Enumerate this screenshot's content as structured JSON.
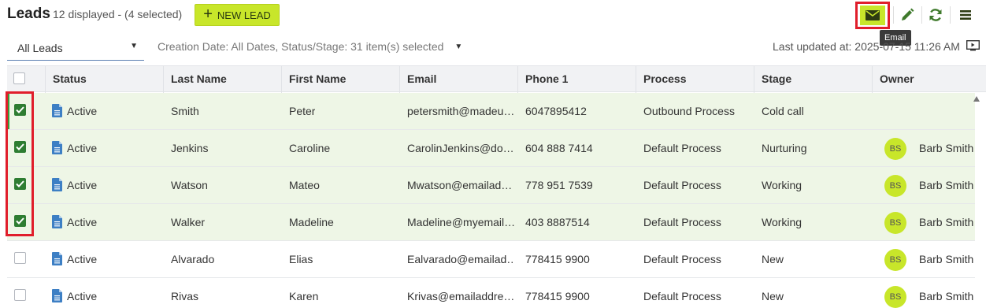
{
  "header": {
    "title": "Leads",
    "subtitle": "12 displayed - (4 selected)",
    "new_lead_label": "NEW LEAD",
    "tooltip": "Email"
  },
  "filters": {
    "view": "All Leads",
    "criteria": "Creation Date: All Dates, Status/Stage: 31 item(s) selected",
    "last_updated": "Last updated at: 2025-07-15 11:26 AM"
  },
  "table": {
    "columns": [
      "Status",
      "Last Name",
      "First Name",
      "Email",
      "Phone 1",
      "Process",
      "Stage",
      "Owner"
    ],
    "rows": [
      {
        "selected": true,
        "status": "Active",
        "last_name": "Smith",
        "first_name": "Peter",
        "email": "petersmith@madeu…",
        "phone": "6047895412",
        "process": "Outbound Process",
        "stage": "Cold call",
        "owner_initials": "",
        "owner": ""
      },
      {
        "selected": true,
        "status": "Active",
        "last_name": "Jenkins",
        "first_name": "Caroline",
        "email": "CarolinJenkins@do…",
        "phone": "604 888 7414",
        "process": "Default Process",
        "stage": "Nurturing",
        "owner_initials": "BS",
        "owner": "Barb Smith"
      },
      {
        "selected": true,
        "status": "Active",
        "last_name": "Watson",
        "first_name": "Mateo",
        "email": "Mwatson@emailad…",
        "phone": "778 951 7539",
        "process": "Default Process",
        "stage": "Working",
        "owner_initials": "BS",
        "owner": "Barb Smith"
      },
      {
        "selected": true,
        "status": "Active",
        "last_name": "Walker",
        "first_name": "Madeline",
        "email": "Madeline@myemail…",
        "phone": "403 8887514",
        "process": "Default Process",
        "stage": "Working",
        "owner_initials": "BS",
        "owner": "Barb Smith"
      },
      {
        "selected": false,
        "status": "Active",
        "last_name": "Alvarado",
        "first_name": "Elias",
        "email": "Ealvarado@emailad…",
        "phone": "778415 9900",
        "process": "Default Process",
        "stage": "New",
        "owner_initials": "BS",
        "owner": "Barb Smith"
      },
      {
        "selected": false,
        "status": "Active",
        "last_name": "Rivas",
        "first_name": "Karen",
        "email": "Krivas@emailaddre…",
        "phone": "778415 9900",
        "process": "Default Process",
        "stage": "New",
        "owner_initials": "BS",
        "owner": "Barb Smith"
      }
    ]
  },
  "colors": {
    "accent": "#c8e62a",
    "checked": "#2e7d32",
    "selected_row": "#eef6e6",
    "highlight": "#e01e2b",
    "status_icon": "#3d7fc4"
  },
  "icons": {
    "email": "envelope-icon",
    "edit": "pencil-icon",
    "refresh": "refresh-icon",
    "menu": "menu-icon",
    "status": "document-icon"
  }
}
